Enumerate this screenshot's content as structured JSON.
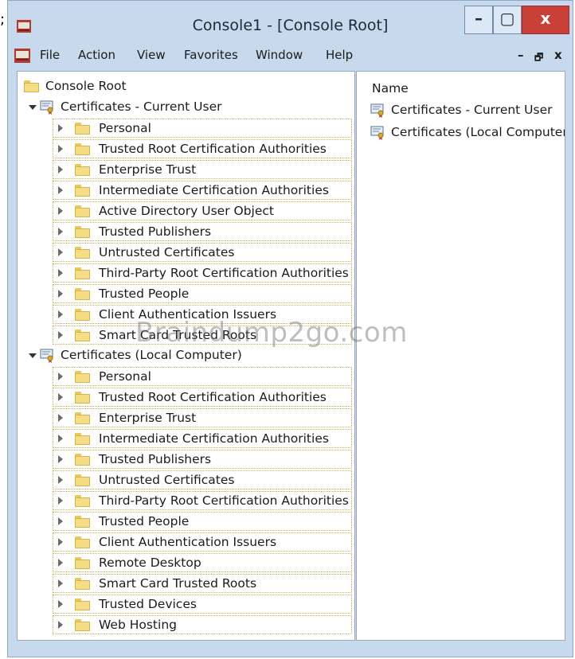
{
  "stray_char": ";",
  "window": {
    "title": "Console1 - [Console Root]",
    "controls": {
      "minimize": "–",
      "maximize": "▢",
      "close": "x"
    }
  },
  "menu": {
    "items": [
      "File",
      "Action",
      "View",
      "Favorites",
      "Window",
      "Help"
    ],
    "mdi_controls": {
      "minimize": "–",
      "restore": "🗗",
      "close": "x"
    }
  },
  "tree": {
    "root": "Console Root",
    "stores": [
      {
        "label": "Certificates - Current User",
        "children": [
          "Personal",
          "Trusted Root Certification Authorities",
          "Enterprise Trust",
          "Intermediate Certification Authorities",
          "Active Directory User Object",
          "Trusted Publishers",
          "Untrusted Certificates",
          "Third-Party Root Certification Authorities",
          "Trusted People",
          "Client Authentication Issuers",
          "Smart Card Trusted Roots"
        ]
      },
      {
        "label": "Certificates (Local Computer)",
        "children": [
          "Personal",
          "Trusted Root Certification Authorities",
          "Enterprise Trust",
          "Intermediate Certification Authorities",
          "Trusted Publishers",
          "Untrusted Certificates",
          "Third-Party Root Certification Authorities",
          "Trusted People",
          "Client Authentication Issuers",
          "Remote Desktop",
          "Smart Card Trusted Roots",
          "Trusted Devices",
          "Web Hosting"
        ]
      }
    ]
  },
  "list": {
    "column_header": "Name",
    "items": [
      "Certificates - Current User",
      "Certificates (Local Computer)"
    ]
  },
  "watermark": "Braindump2go.com",
  "icons": {
    "app": "mmc-app-icon",
    "folder": "folder-icon",
    "cert_store": "certificate-store-icon"
  },
  "colors": {
    "chrome": "#c6d9ed",
    "close_button": "#c94037",
    "folder": "#f6dd84",
    "selection_border": "#c9b25e"
  }
}
